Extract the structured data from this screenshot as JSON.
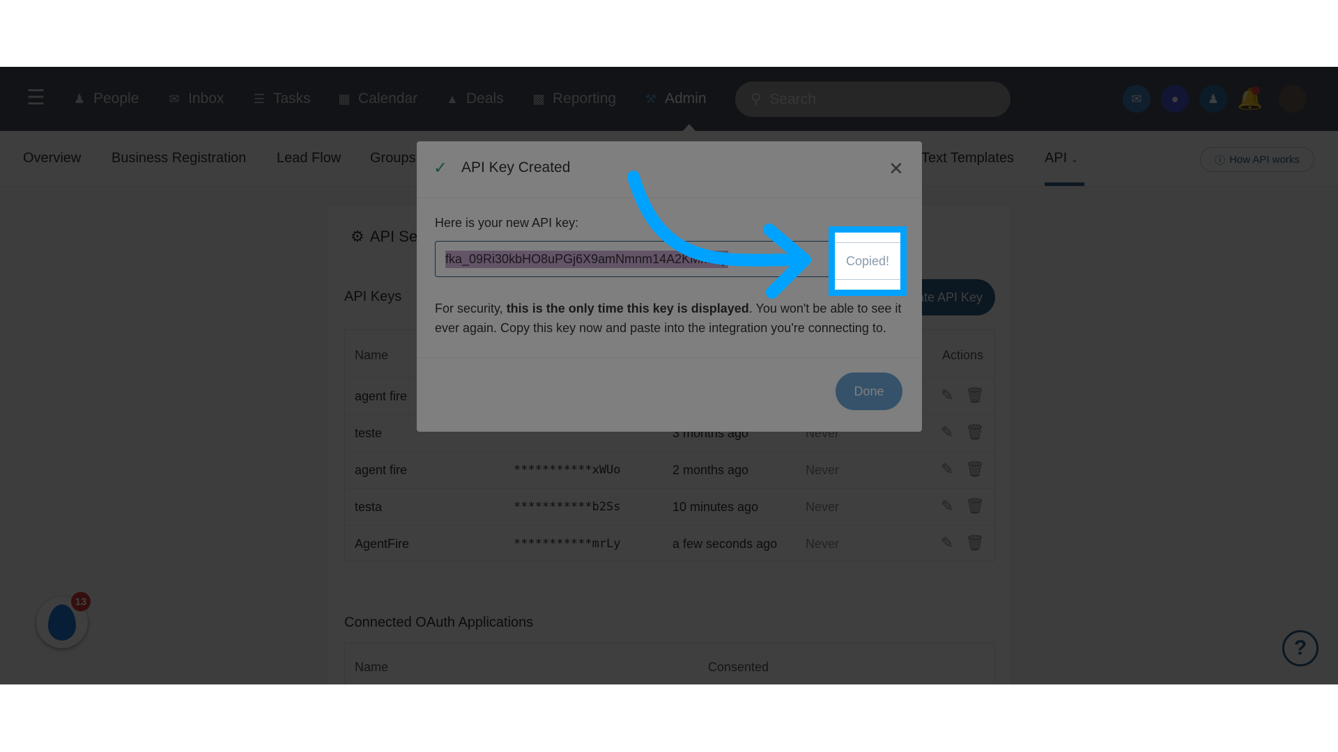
{
  "nav": {
    "items": [
      {
        "label": "People",
        "icon": "person-icon"
      },
      {
        "label": "Inbox",
        "icon": "inbox-icon"
      },
      {
        "label": "Tasks",
        "icon": "list-icon"
      },
      {
        "label": "Calendar",
        "icon": "calendar-icon"
      },
      {
        "label": "Deals",
        "icon": "money-bag-icon"
      },
      {
        "label": "Reporting",
        "icon": "chart-icon"
      },
      {
        "label": "Admin",
        "icon": "wrench-icon",
        "active": true
      }
    ],
    "search_placeholder": "Search"
  },
  "subnav": {
    "items": [
      "Overview",
      "Business Registration",
      "Lead Flow",
      "Groups",
      "Text Templates",
      "API"
    ],
    "active": "API",
    "how_api_works": "How API works"
  },
  "card": {
    "title": "API Settings",
    "api_keys_title": "API Keys",
    "create_button": "Create API Key",
    "columns": {
      "name": "Name",
      "actions": "Actions"
    },
    "rows": [
      {
        "name": "agent fire",
        "key": "",
        "created": "",
        "last_used": ""
      },
      {
        "name": "teste",
        "key": "",
        "created": "3 months ago",
        "last_used": "Never"
      },
      {
        "name": "agent fire",
        "key": "***********xWUo",
        "created": "2 months ago",
        "last_used": "Never"
      },
      {
        "name": "testa",
        "key": "***********b2Ss",
        "created": "10 minutes ago",
        "last_used": "Never"
      },
      {
        "name": "AgentFire",
        "key": "***********mrLy",
        "created": "a few seconds ago",
        "last_used": "Never"
      }
    ],
    "oauth_title": "Connected OAuth Applications",
    "oauth_columns": {
      "name": "Name",
      "consented": "Consented"
    }
  },
  "dialog": {
    "title": "API Key Created",
    "label": "Here is your new API key:",
    "api_key": "fka_09Ri30kbHO8uPGj6X9amNmnm14A2KMmrLy",
    "copied": "Copied!",
    "security_pre": "For security, ",
    "security_bold": "this is the only time this key is displayed",
    "security_post": ". You won't be able to see it ever again. Copy this key now and paste into the integration you're connecting to.",
    "done": "Done"
  },
  "widget": {
    "badge_count": "13"
  },
  "colors": {
    "accent": "#2c5d86",
    "annotation": "#00a2ff",
    "check": "#2e9e6a"
  }
}
